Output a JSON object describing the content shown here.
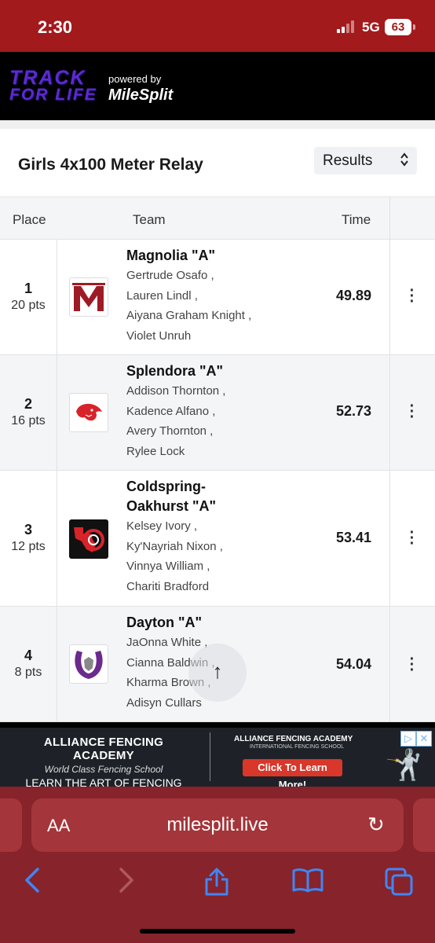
{
  "status_bar": {
    "time": "2:30",
    "network": "5G",
    "battery": "63"
  },
  "header": {
    "logo_line1": "TRACK",
    "logo_line2": "FOR LIFE",
    "powered_by": "powered by",
    "brand": "MileSplit"
  },
  "event": {
    "title": "Girls 4x100 Meter Relay",
    "view_select": "Results"
  },
  "table": {
    "columns": {
      "place": "Place",
      "team": "Team",
      "time": "Time"
    },
    "rows": [
      {
        "place": "1",
        "points": "20 pts",
        "team": "Magnolia \"A\"",
        "logo": "magnolia-m-logo",
        "athletes": [
          "Gertrude Osafo ,",
          "Lauren Lindl ,",
          "Aiyana Graham Knight ,",
          "Violet Unruh"
        ],
        "time": "49.89"
      },
      {
        "place": "2",
        "points": "16 pts",
        "team": "Splendora \"A\"",
        "logo": "splendora-wildcat-logo",
        "athletes": [
          "Addison Thornton ,",
          "Kadence Alfano ,",
          "Avery Thornton ,",
          "Rylee Lock"
        ],
        "time": "52.73"
      },
      {
        "place": "3",
        "points": "12 pts",
        "team_line1": "Coldspring-",
        "team_line2": "Oakhurst \"A\"",
        "logo": "coldspring-texas-logo",
        "athletes": [
          "Kelsey Ivory ,",
          "Ky'Nayriah Nixon ,",
          "Vinnya William ,",
          "Chariti Bradford"
        ],
        "time": "53.41"
      },
      {
        "place": "4",
        "points": "8 pts",
        "team": "Dayton \"A\"",
        "logo": "dayton-horseshoe-logo",
        "athletes": [
          "JaOnna White ,",
          "Cianna Baldwin ,",
          "Kharma Brown ,",
          "Adisyn Cullars"
        ],
        "time": "54.04"
      }
    ]
  },
  "ad": {
    "title": "ALLIANCE FENCING ACADEMY",
    "subtitle": "World Class Fencing School",
    "tagline": "LEARN THE ART OF FENCING",
    "right_title": "ALLIANCE FENCING ACADEMY",
    "right_subtitle": "INTERNATIONAL FENCING SCHOOL",
    "cta": "Click To Learn More!"
  },
  "browser": {
    "text_size": "AA",
    "url": "milesplit.live"
  },
  "colors": {
    "brand_red": "#a21a1c",
    "browser_red": "#87232a",
    "link_blue": "#3f86f5"
  }
}
